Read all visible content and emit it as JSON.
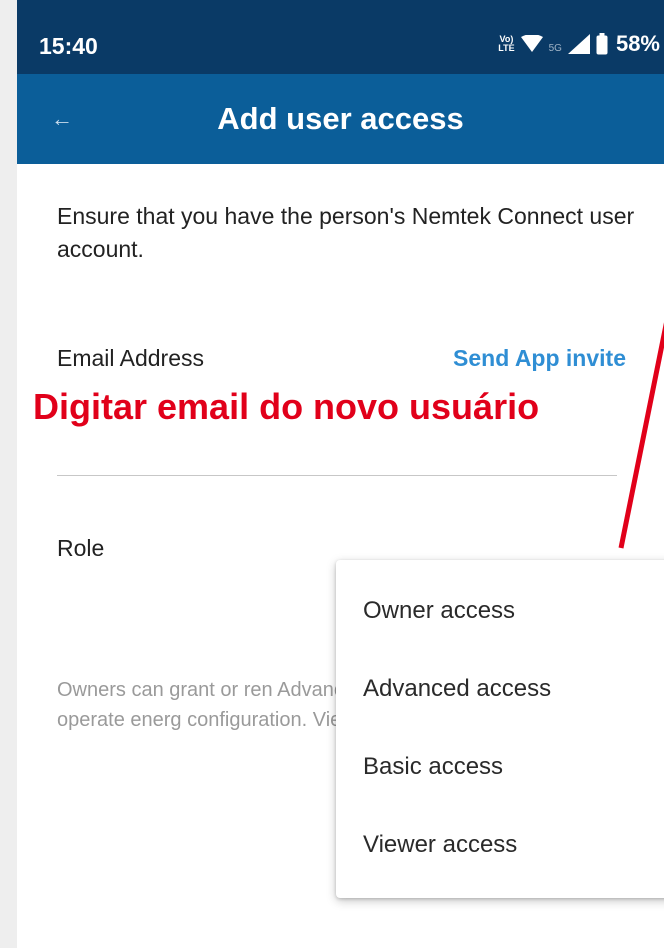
{
  "status_bar": {
    "time": "15:40",
    "volte_top": "Vo)",
    "volte_bottom": "LTE",
    "network": "5G",
    "battery": "58%"
  },
  "app_bar": {
    "back_icon": "arrow-left-icon",
    "title": "Add user access"
  },
  "form": {
    "intro": "Ensure that you have the person's Nemtek Connect user account.",
    "email_label": "Email Address",
    "invite_link": "Send App invite",
    "email_value": "",
    "role_label": "Role",
    "role_description": "Owners can grant or ren Advanced users can edi users can operate energ configuration. View Only"
  },
  "annotation": {
    "text": "Digitar email do novo usuário",
    "color": "#e1001a"
  },
  "role_menu": {
    "options": [
      "Owner access",
      "Advanced access",
      "Basic access",
      "Viewer access"
    ]
  },
  "colors": {
    "status_bar": "#0a3a66",
    "app_bar": "#0b5e99",
    "link": "#2f8ed4"
  }
}
